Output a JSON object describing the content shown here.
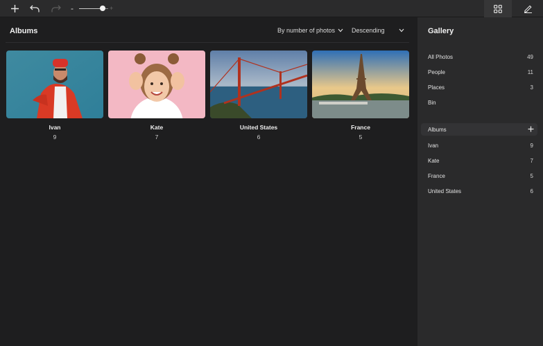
{
  "toolbar": {
    "icons": {
      "add": "plus-icon",
      "undo": "undo-icon",
      "redo": "redo-icon",
      "grid": "grid-icon",
      "edit": "pencil-icon"
    },
    "zoom": {
      "minus_label": "-",
      "plus_label": "+",
      "value": 0.8
    }
  },
  "main": {
    "title": "Albums",
    "sort_label": "By number of photos",
    "order_label": "Descending",
    "albums": [
      {
        "name": "Ivan",
        "count": "9"
      },
      {
        "name": "Kate",
        "count": "7"
      },
      {
        "name": "United States",
        "count": "6"
      },
      {
        "name": "France",
        "count": "5"
      }
    ]
  },
  "sidebar": {
    "title": "Gallery",
    "library": [
      {
        "label": "All Photos",
        "count": "49"
      },
      {
        "label": "People",
        "count": "11"
      },
      {
        "label": "Places",
        "count": "3"
      },
      {
        "label": "Bin",
        "count": ""
      }
    ],
    "albums_header": "Albums",
    "albums": [
      {
        "label": "Ivan",
        "count": "9"
      },
      {
        "label": "Kate",
        "count": "7"
      },
      {
        "label": "France",
        "count": "5"
      },
      {
        "label": "United States",
        "count": "6"
      }
    ]
  },
  "colors": {
    "background": "#1e1e1f",
    "sidebar": "#2a2a2b",
    "toolbar": "#2b2b2c"
  }
}
